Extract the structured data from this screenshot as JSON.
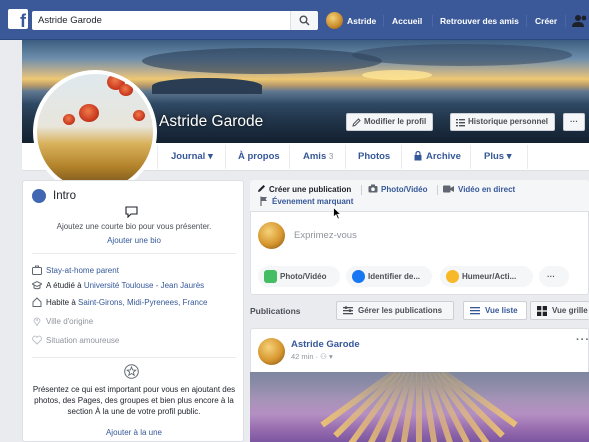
{
  "topbar": {
    "search_value": "Astride Garode",
    "user_name": "Astride",
    "nav": [
      "Accueil",
      "Retrouver des amis",
      "Créer"
    ]
  },
  "profile": {
    "name": "Astride Garode",
    "edit_button": "Modifier le profil",
    "history_button": "Historique personnel",
    "more_button": "···"
  },
  "tabs": [
    {
      "label": "Journal ▾"
    },
    {
      "label": "À propos"
    },
    {
      "label": "Amis",
      "count": "3"
    },
    {
      "label": "Photos"
    },
    {
      "label": "Archive"
    },
    {
      "label": "Plus ▾"
    }
  ],
  "intro": {
    "title": "Intro",
    "bio_prompt": "Ajoutez une courte bio pour vous présenter.",
    "bio_link": "Ajouter une bio",
    "rows": [
      {
        "text": "Stay-at-home parent",
        "icon": "briefcase-icon"
      },
      {
        "prefix": "A étudié à ",
        "text": "Université Toulouse - Jean Jaurès",
        "icon": "graduation-cap-icon"
      },
      {
        "prefix": "Habite à ",
        "text": "Saint-Girons, Midi-Pyrenees, France",
        "icon": "house-icon"
      },
      {
        "text": "Ville d'origine",
        "icon": "location-pin-icon"
      },
      {
        "text": "Situation amoureuse",
        "icon": "heart-icon"
      }
    ],
    "featured_text": "Présentez ce qui est important pour vous en ajoutant des photos, des Pages, des groupes et bien plus encore à la section À la une de votre profil public.",
    "featured_link": "Ajouter à la une"
  },
  "composer": {
    "tabs": [
      "Créer une publication",
      "Photo/Vidéo",
      "Vidéo en direct",
      "Évenement marquant"
    ],
    "placeholder": "Exprimez-vous",
    "actions": [
      "Photo/Vidéo",
      "Identifier de...",
      "Humeur/Acti..."
    ],
    "more": "···"
  },
  "publications": {
    "label": "Publications",
    "manage": "Gérer les publications",
    "list_view": "Vue liste",
    "grid_view": "Vue grille"
  },
  "post": {
    "author": "Astride Garode",
    "meta": "42 min · ⚇ ▾",
    "more": "···"
  },
  "colors": {
    "brand": "#3b5998",
    "link": "#365899"
  }
}
